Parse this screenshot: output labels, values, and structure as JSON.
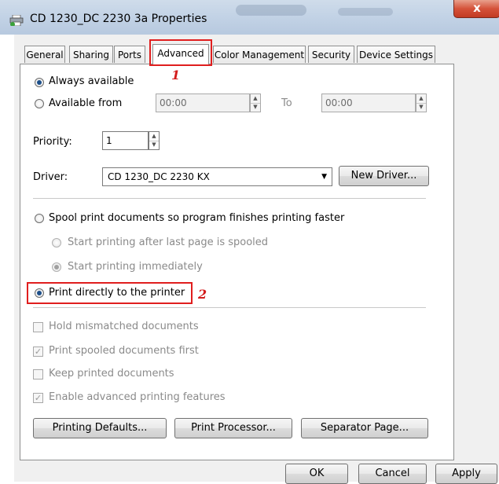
{
  "window": {
    "title": "CD 1230_DC 2230 3a Properties",
    "close_label": "x"
  },
  "tabs": [
    {
      "label": "General"
    },
    {
      "label": "Sharing"
    },
    {
      "label": "Ports"
    },
    {
      "label": "Advanced",
      "active": true
    },
    {
      "label": "Color Management"
    },
    {
      "label": "Security"
    },
    {
      "label": "Device Settings"
    }
  ],
  "availability": {
    "always_label": "Always available",
    "from_label": "Available from",
    "from_time": "00:00",
    "to_label": "To",
    "to_time": "00:00",
    "selected": "always"
  },
  "priority": {
    "label": "Priority:",
    "value": "1"
  },
  "driver": {
    "label": "Driver:",
    "value": "CD 1230_DC 2230 KX",
    "new_driver_label": "New Driver..."
  },
  "spool": {
    "spool_label": "Spool print documents so program finishes printing faster",
    "after_last_page_label": "Start printing after last page is spooled",
    "immediately_label": "Start printing immediately",
    "direct_label": "Print directly to the printer",
    "selected": "direct"
  },
  "options": [
    {
      "label": "Hold mismatched documents",
      "checked": false
    },
    {
      "label": "Print spooled documents first",
      "checked": true
    },
    {
      "label": "Keep printed documents",
      "checked": false
    },
    {
      "label": "Enable advanced printing features",
      "checked": true
    }
  ],
  "bottom_buttons": {
    "printing_defaults": "Printing Defaults...",
    "print_processor": "Print Processor...",
    "separator_page": "Separator Page..."
  },
  "dialog_buttons": {
    "ok": "OK",
    "cancel": "Cancel",
    "apply": "Apply"
  },
  "annotations": {
    "advanced_tab_marker": "1",
    "direct_print_marker": "2",
    "color": "#e01e1e"
  },
  "colors": {
    "radio_dot": "#1c4f8a",
    "panel_bg": "#ffffff",
    "frame_bg": "#f0f0f0"
  }
}
